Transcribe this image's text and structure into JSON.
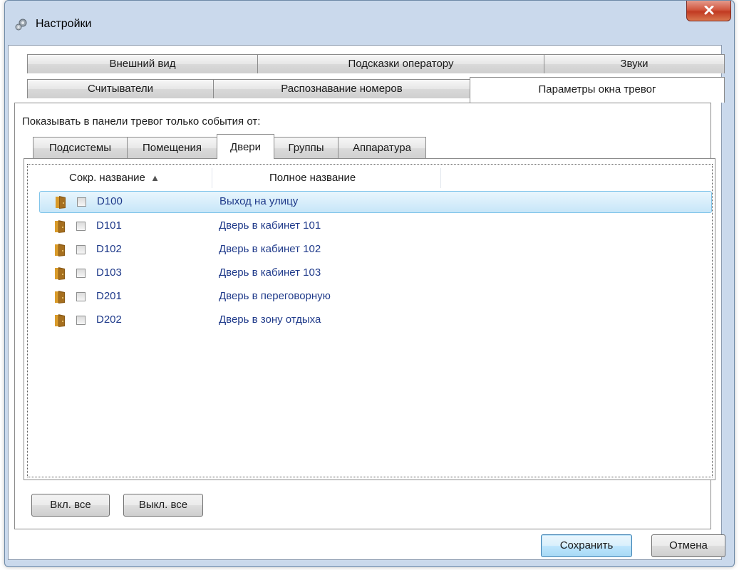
{
  "window": {
    "title": "Настройки"
  },
  "tabs": {
    "top_row": [
      {
        "label": "Внешний вид"
      },
      {
        "label": "Подсказки оператору"
      },
      {
        "label": "Звуки"
      }
    ],
    "bottom_row": [
      {
        "label": "Считыватели"
      },
      {
        "label": "Распознавание номеров"
      },
      {
        "label": "Параметры окна тревог",
        "active": true
      }
    ]
  },
  "filter_label": "Показывать в панели тревог только события от:",
  "subtabs": [
    {
      "label": "Подсистемы"
    },
    {
      "label": "Помещения"
    },
    {
      "label": "Двери",
      "active": true
    },
    {
      "label": "Группы"
    },
    {
      "label": "Аппаратура"
    }
  ],
  "columns": {
    "short": "Сокр. название",
    "full": "Полное название",
    "sort_indicator": "▲"
  },
  "rows": [
    {
      "short": "D100",
      "full": "Выход на улицу",
      "checked": false,
      "selected": true
    },
    {
      "short": "D101",
      "full": "Дверь в кабинет 101",
      "checked": false
    },
    {
      "short": "D102",
      "full": "Дверь в кабинет 102",
      "checked": false
    },
    {
      "short": "D103",
      "full": "Дверь в кабинет 103",
      "checked": false
    },
    {
      "short": "D201",
      "full": "Дверь в переговорную",
      "checked": false
    },
    {
      "short": "D202",
      "full": "Дверь в зону отдыха",
      "checked": false
    }
  ],
  "buttons": {
    "enable_all": "Вкл. все",
    "disable_all": "Выкл. все",
    "save": "Сохранить",
    "cancel": "Отмена"
  },
  "icons": {
    "title": "settings-gear-icon",
    "close": "close-icon",
    "row": "door-icon",
    "sort": "sort-ascending-icon"
  },
  "colors": {
    "frame": "#cad9ec",
    "close_button": "#c13a22",
    "link_text": "#1f3a8a",
    "selection": "#c7e6f8"
  }
}
